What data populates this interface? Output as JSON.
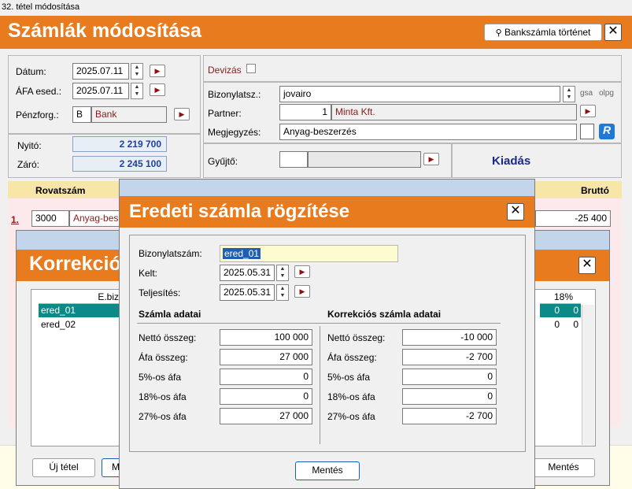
{
  "window": {
    "title": "32. tétel módosítása"
  },
  "header": {
    "title": "Számlák módosítása",
    "bank_history_label": "Bankszámla történet",
    "close": "✕"
  },
  "left": {
    "datum_label": "Dátum:",
    "datum_value": "2025.07.11",
    "afa_label": "ÁFA esed.:",
    "afa_value": "2025.07.11",
    "penzforg_label": "Pénzforg.:",
    "penzforg_code": "B",
    "penzforg_value": "Bank",
    "nyito_label": "Nyitó:",
    "nyito_value": "2 219 700",
    "zaro_label": "Záró:",
    "zaro_value": "2 245 100"
  },
  "right": {
    "devizas_label": "Devizás",
    "bizonylat_label": "Bizonylatsz.:",
    "bizonylat_value": "jovairo",
    "gsa": "gsa",
    "olpg": "olpg",
    "partner_label": "Partner:",
    "partner_num": "1",
    "partner_name": "Minta Kft.",
    "megjegyzes_label": "Megjegyzés:",
    "megjegyzes_value": "Anyag-beszerzés",
    "gyujto_label": "Gyűjtő:",
    "kiadas": "Kiadás"
  },
  "table": {
    "col_rovat": "Rovatszám",
    "col_brutto": "Bruttó",
    "row_num": "1.",
    "row_code": "3000",
    "row_name": "Anyag-besz",
    "row_brutto": "-25 400"
  },
  "korrekcio": {
    "title": "Korrekció",
    "close": "✕",
    "col_ebizs": "E.bizs",
    "col_18": "18%",
    "rows": [
      {
        "name": "ered_01",
        "v1": "0",
        "v2": "0"
      },
      {
        "name": "ered_02",
        "v1": "0",
        "v2": "0"
      }
    ],
    "uj_tetel": "Új tétel",
    "m_label": "M",
    "mentes": "Mentés"
  },
  "modal": {
    "title": "Eredeti számla rögzítése",
    "close": "✕",
    "bizonylat_label": "Bizonylatszám:",
    "bizonylat_value": "ered_01",
    "kelt_label": "Kelt:",
    "kelt_value": "2025.05.31",
    "teljesites_label": "Teljesítés:",
    "teljesites_value": "2025.05.31",
    "szamla_header": "Számla adatai",
    "korr_header": "Korrekciós számla adatai",
    "rows": [
      {
        "label": "Nettó összeg:",
        "left": "100 000",
        "right": "-10 000"
      },
      {
        "label": "Áfa összeg:",
        "left": "27 000",
        "right": "-2 700"
      },
      {
        "label": "5%-os áfa",
        "left": "0",
        "right": "0"
      },
      {
        "label": "18%-os áfa",
        "left": "0",
        "right": "0"
      },
      {
        "label": "27%-os áfa",
        "left": "27 000",
        "right": "-2 700"
      }
    ],
    "mentes": "Mentés"
  }
}
